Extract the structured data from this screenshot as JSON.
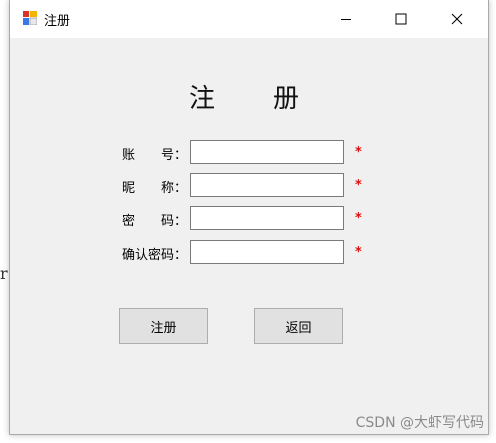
{
  "window": {
    "title": "注册",
    "minimize_symbol": "—",
    "maximize_symbol": "□",
    "close_symbol": "✕"
  },
  "background": {
    "stray_char": "r"
  },
  "form": {
    "heading": "注　　册",
    "fields": [
      {
        "label": "账　　号：",
        "value": "",
        "required_mark": "*"
      },
      {
        "label": "昵　　称：",
        "value": "",
        "required_mark": "*"
      },
      {
        "label": "密　　码：",
        "value": "",
        "required_mark": "*"
      },
      {
        "label": "确认密码：",
        "value": "",
        "required_mark": "*"
      }
    ],
    "register_label": "注册",
    "back_label": "返回"
  },
  "watermark": "CSDN @大虾写代码",
  "colors": {
    "required": "#e01010",
    "button_bg": "#e1e1e1",
    "window_bg": "#f0f0f0"
  }
}
